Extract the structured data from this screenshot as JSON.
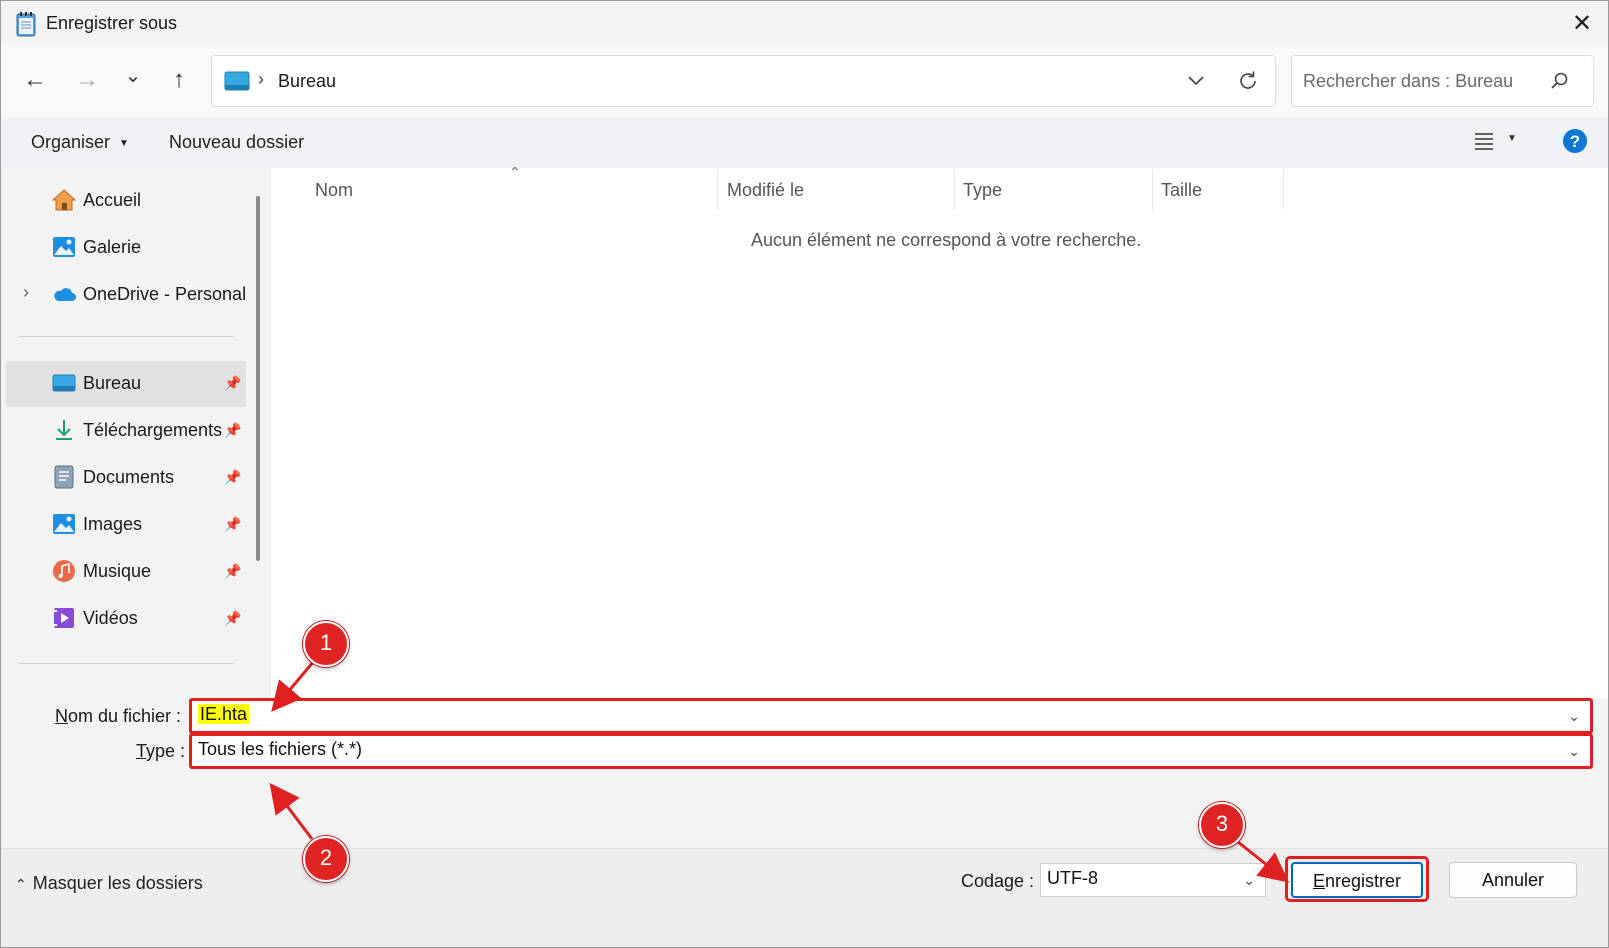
{
  "window": {
    "title": "Enregistrer sous",
    "close_label": "✕"
  },
  "nav": {
    "back_label": "←",
    "forward_label": "→",
    "recent_label": "⌄",
    "up_label": "↑",
    "breadcrumb_sep": "›",
    "location": "Bureau",
    "search_placeholder": "Rechercher dans : Bureau"
  },
  "toolbar": {
    "organize_label": "Organiser",
    "new_folder_label": "Nouveau dossier"
  },
  "sidebar": {
    "top_items": [
      {
        "label": "Accueil"
      },
      {
        "label": "Galerie"
      },
      {
        "label": "OneDrive - Personal"
      }
    ],
    "pinned_items": [
      {
        "label": "Bureau"
      },
      {
        "label": "Téléchargements"
      },
      {
        "label": "Documents"
      },
      {
        "label": "Images"
      },
      {
        "label": "Musique"
      },
      {
        "label": "Vidéos"
      }
    ]
  },
  "columns": {
    "name": "Nom",
    "modified": "Modifié le",
    "type": "Type",
    "size": "Taille"
  },
  "content": {
    "empty_message": "Aucun élément ne correspond à votre recherche."
  },
  "form": {
    "filename_label_key": "N",
    "filename_label_rest": "om du fichier :",
    "filename_value": "IE.hta",
    "type_label_key": "T",
    "type_label_rest": "ype :",
    "type_value": "Tous les fichiers  (*.*)"
  },
  "footer": {
    "hide_folders_label": "Masquer les dossiers",
    "encoding_label": "Codage :",
    "encoding_value": "UTF-8",
    "save_key": "E",
    "save_rest": "nregistrer",
    "cancel_label": "Annuler"
  },
  "callouts": [
    "1",
    "2",
    "3"
  ],
  "colors": {
    "accent": "#0067c0",
    "annotation": "#e02020",
    "highlight": "#ffff00"
  }
}
